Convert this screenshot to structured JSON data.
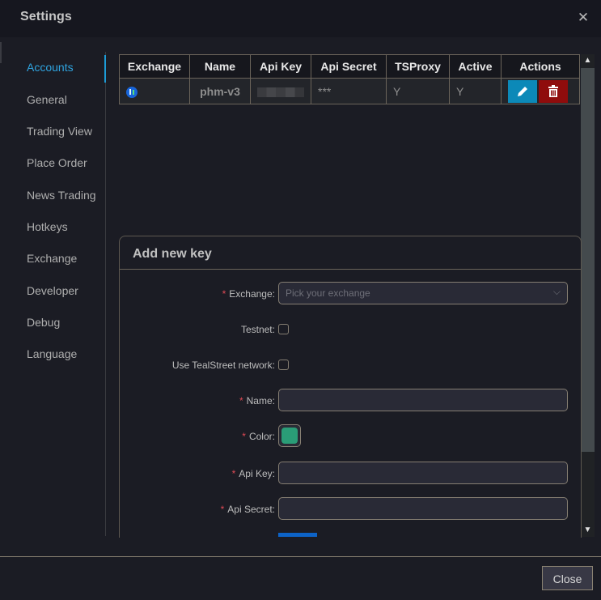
{
  "dialog": {
    "title": "Settings",
    "close_icon": "close-icon"
  },
  "sidebar": {
    "active": "Accounts",
    "items": [
      {
        "label": "Accounts"
      },
      {
        "label": "General"
      },
      {
        "label": "Trading View"
      },
      {
        "label": "Place Order"
      },
      {
        "label": "News Trading"
      },
      {
        "label": "Hotkeys"
      },
      {
        "label": "Exchange"
      },
      {
        "label": "Developer"
      },
      {
        "label": "Debug"
      },
      {
        "label": "Language"
      }
    ]
  },
  "accounts_table": {
    "columns": [
      "Exchange",
      "Name",
      "Api Key",
      "Api Secret",
      "TSProxy",
      "Active",
      "Actions"
    ],
    "rows": [
      {
        "exchange_icon": "exchange-logo-icon",
        "name": "phm-v3",
        "api_key": "(blurred)",
        "api_secret": "***",
        "tsproxy": "Y",
        "active": "Y",
        "actions": [
          "edit",
          "delete"
        ]
      }
    ]
  },
  "add_key_form": {
    "title": "Add new key",
    "fields": {
      "exchange": {
        "label": "Exchange",
        "required": true,
        "placeholder": "Pick your exchange",
        "value": ""
      },
      "testnet": {
        "label": "Testnet",
        "required": false,
        "checked": false
      },
      "tealstreet_network": {
        "label": "Use TealStreet network",
        "required": false,
        "checked": false
      },
      "name": {
        "label": "Name",
        "required": true,
        "value": ""
      },
      "color": {
        "label": "Color",
        "required": true,
        "value": "#2a9d77"
      },
      "api_key": {
        "label": "Api Key",
        "required": true,
        "value": ""
      },
      "api_secret": {
        "label": "Api Secret",
        "required": true,
        "value": ""
      }
    },
    "required_marker": "*",
    "label_suffix": ":"
  },
  "footer": {
    "close_label": "Close"
  },
  "colors": {
    "accent": "#2fa4e0",
    "edit_button": "#0c89b8",
    "delete_button": "#8f0c0c",
    "account_name": "#d0616b",
    "required": "#e04a55"
  }
}
